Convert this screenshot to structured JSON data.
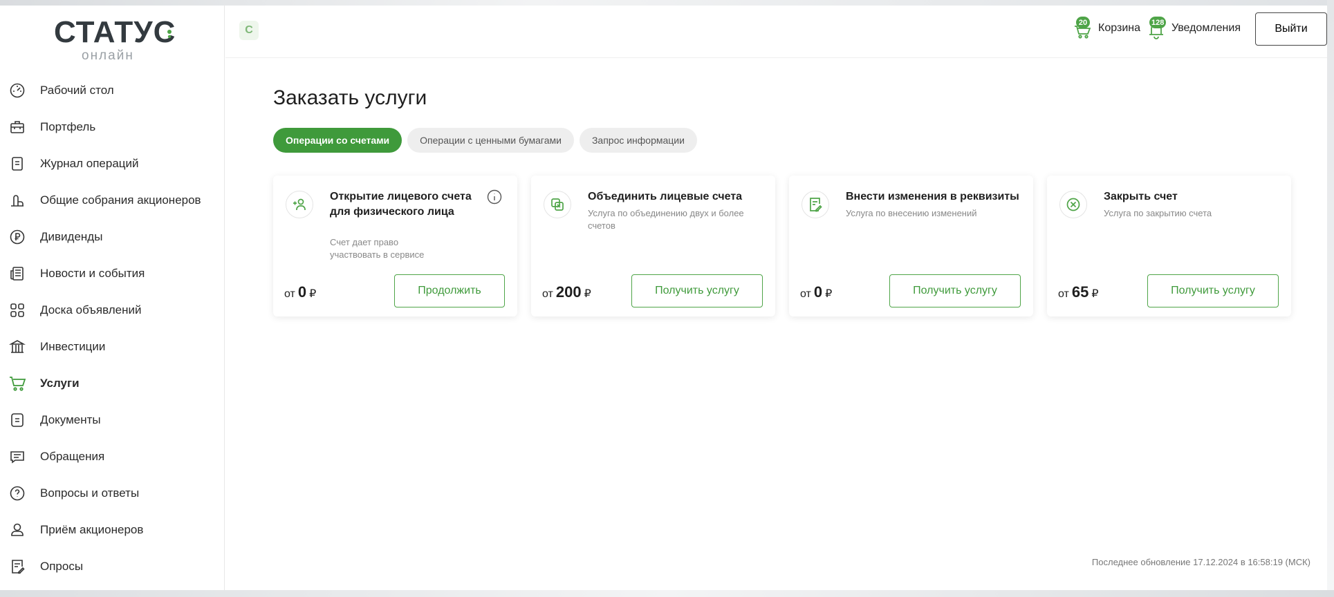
{
  "logo": {
    "main": "СТАТУС",
    "sub": "онлайн"
  },
  "sidebar": {
    "items": [
      {
        "label": "Рабочий стол",
        "icon": "dashboard-icon"
      },
      {
        "label": "Портфель",
        "icon": "briefcase-icon"
      },
      {
        "label": "Журнал операций",
        "icon": "journal-icon"
      },
      {
        "label": "Общие собрания акционеров",
        "icon": "meeting-icon"
      },
      {
        "label": "Дивиденды",
        "icon": "ruble-coin-icon"
      },
      {
        "label": "Новости и события",
        "icon": "news-icon"
      },
      {
        "label": "Доска объявлений",
        "icon": "board-icon"
      },
      {
        "label": "Инвестиции",
        "icon": "investments-icon"
      },
      {
        "label": "Услуги",
        "icon": "cart-icon",
        "active": true
      },
      {
        "label": "Документы",
        "icon": "documents-icon"
      },
      {
        "label": "Обращения",
        "icon": "chat-icon"
      },
      {
        "label": "Вопросы и ответы",
        "icon": "question-icon"
      },
      {
        "label": "Приём акционеров",
        "icon": "person-icon"
      },
      {
        "label": "Опросы",
        "icon": "survey-icon"
      }
    ]
  },
  "header": {
    "brand_mini": "С",
    "cart": {
      "label": "Корзина",
      "count": "20"
    },
    "notifications": {
      "label": "Уведомления",
      "count": "128"
    },
    "logout_label": "Выйти"
  },
  "main": {
    "title": "Заказать услуги",
    "tabs": [
      {
        "label": "Операции со счетами",
        "active": true
      },
      {
        "label": "Операции с ценными бумагами",
        "active": false
      },
      {
        "label": "Запрос информации",
        "active": false
      }
    ],
    "cards": [
      {
        "title": "Открытие лицевого счета для физического лица",
        "desc": "Счет дает право участвовать в сервисе",
        "price_prefix": "от",
        "price_value": "0",
        "currency": "₽",
        "action": "Продолжить",
        "icon": "add-person-icon",
        "has_info": true
      },
      {
        "title": "Объединить лицевые счета",
        "desc": "Услуга по объединению двух и более счетов",
        "price_prefix": "от",
        "price_value": "200",
        "currency": "₽",
        "action": "Получить услугу",
        "icon": "merge-icon",
        "has_info": false
      },
      {
        "title": "Внести изменения в реквизиты",
        "desc": "Услуга по внесению изменений",
        "price_prefix": "от",
        "price_value": "0",
        "currency": "₽",
        "action": "Получить услугу",
        "icon": "edit-doc-icon",
        "has_info": false
      },
      {
        "title": "Закрыть счет",
        "desc": "Услуга по закрытию счета",
        "price_prefix": "от",
        "price_value": "65",
        "currency": "₽",
        "action": "Получить услугу",
        "icon": "close-circle-icon",
        "has_info": false
      }
    ],
    "last_update": "Последнее обновление 17.12.2024 в 16:58:19 (МСК)"
  },
  "colors": {
    "accent": "#3f9a3b",
    "text": "#1f1f1f",
    "muted": "#888888"
  }
}
